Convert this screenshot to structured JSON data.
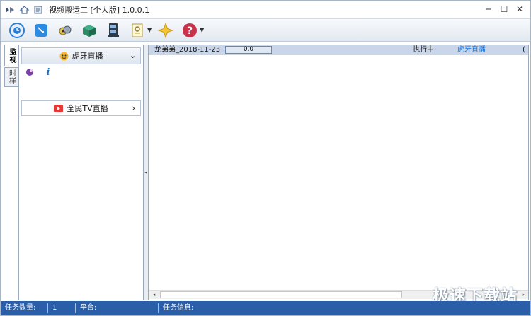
{
  "window": {
    "title": "视频搬运工 [个人版] 1.0.0.1",
    "controls": {
      "minimize": "─",
      "maximize": "☐",
      "close": "✕"
    }
  },
  "titlebar_icons": [
    "video-logo-icon",
    "home-icon",
    "task-icon"
  ],
  "toolbar": {
    "tools": [
      {
        "name": "clock-tool-icon"
      },
      {
        "name": "tag-tool-icon"
      },
      {
        "name": "people-tool-icon"
      },
      {
        "name": "box-tool-icon"
      },
      {
        "name": "filmstrip-tool-icon"
      },
      {
        "name": "settings-doc-tool-icon",
        "has_dropdown": true
      },
      {
        "name": "star-tool-icon"
      },
      {
        "name": "help-tool-icon",
        "has_dropdown": true
      }
    ],
    "dropdown_arrow": "▼"
  },
  "vtabs": {
    "active_label": "监视",
    "inactive_label": "时样"
  },
  "leftpanel": {
    "group1": {
      "label": "虎牙直播",
      "chevron": "⌄"
    },
    "group1_icons": [
      "huya-user-icon",
      "info-icon"
    ],
    "info_glyph": "i",
    "group2": {
      "label": "全民TV直播",
      "chevron": "›"
    }
  },
  "splitter": {
    "glyph": "◂"
  },
  "tasks": [
    {
      "name": "龙弟弟_2018-11-23",
      "progress": "0.0",
      "status": "执行中",
      "platform": "虎牙直播",
      "extra": "("
    }
  ],
  "hscroll": {
    "left": "◂",
    "right": "▸"
  },
  "statusbar": {
    "task_count_label": "任务数量:",
    "task_count_value": "1",
    "platform_label": "平台:",
    "task_info_label": "任务信息:"
  },
  "watermark": "极速下载站",
  "colors": {
    "accent": "#2b5ea8",
    "row_highlight": "#c9d6ea",
    "platform_link": "#1a73d9"
  }
}
